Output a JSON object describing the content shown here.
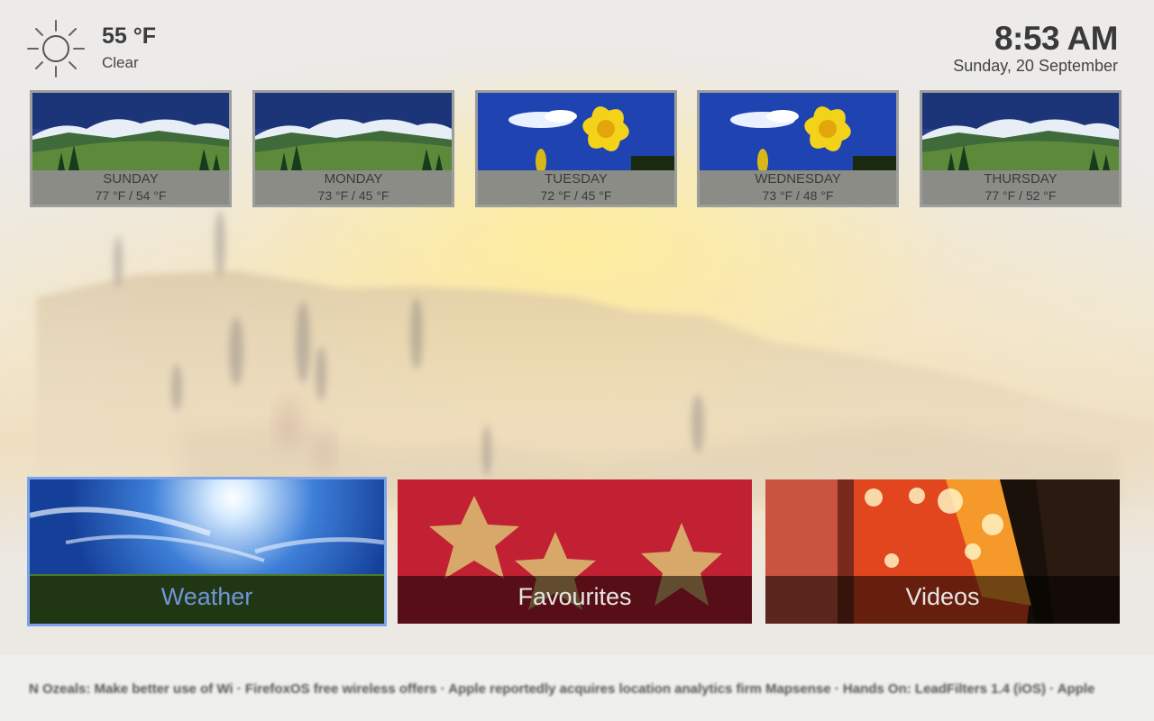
{
  "current": {
    "temperature": "55 °F",
    "condition": "Clear",
    "icon": "sun-icon"
  },
  "clock": {
    "time": "8:53 AM",
    "date": "Sunday, 20 September"
  },
  "forecast": [
    {
      "day": "SUNDAY",
      "temps": "77 °F / 54 °F",
      "image": "mountains"
    },
    {
      "day": "MONDAY",
      "temps": "73 °F / 45 °F",
      "image": "mountains"
    },
    {
      "day": "TUESDAY",
      "temps": "72 °F / 45 °F",
      "image": "daffodil"
    },
    {
      "day": "WEDNESDAY",
      "temps": "73 °F / 48 °F",
      "image": "daffodil"
    },
    {
      "day": "THURSDAY",
      "temps": "77 °F / 52 °F",
      "image": "mountains"
    }
  ],
  "menu": [
    {
      "label": "Weather",
      "active": true
    },
    {
      "label": "Favourites",
      "active": false
    },
    {
      "label": "Videos",
      "active": false
    }
  ],
  "ticker": {
    "text": "N Ozeals: Make better use of Wi · FirefoxOS free wireless offers · Apple reportedly acquires location analytics firm Mapsense · Hands On: LeadFilters 1.4 (iOS) · Apple"
  },
  "colors": {
    "focus_accent": "#7aa3ea",
    "text_dark": "#3c3c3c"
  }
}
